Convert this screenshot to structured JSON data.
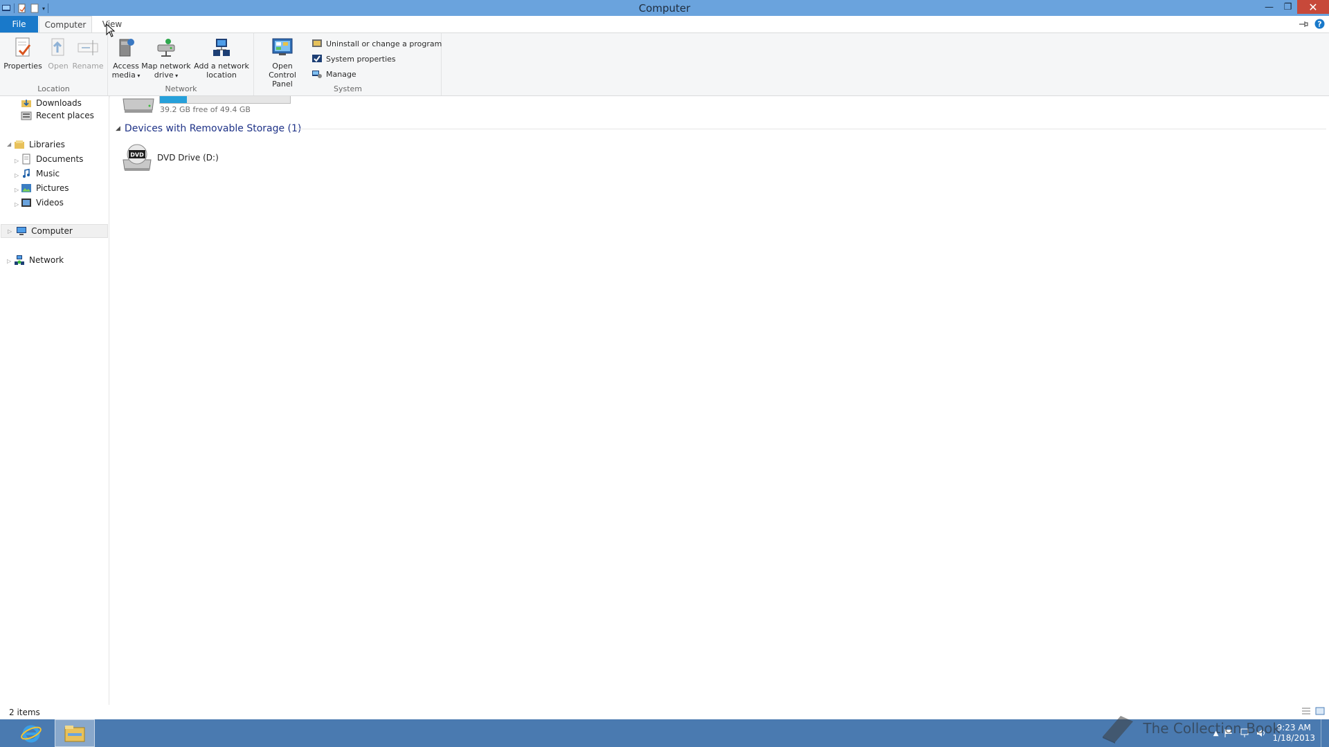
{
  "window": {
    "title": "Computer"
  },
  "tabs": {
    "file": "File",
    "computer": "Computer",
    "view": "View"
  },
  "ribbon": {
    "location": {
      "label": "Location",
      "properties": "Properties",
      "open": "Open",
      "rename": "Rename"
    },
    "network": {
      "label": "Network",
      "access_media_1": "Access",
      "access_media_2": "media",
      "map_drive_1": "Map network",
      "map_drive_2": "drive",
      "add_location_1": "Add a network",
      "add_location_2": "location"
    },
    "system": {
      "label": "System",
      "control_panel_1": "Open Control",
      "control_panel_2": "Panel",
      "uninstall": "Uninstall or change a program",
      "system_properties": "System properties",
      "manage": "Manage"
    }
  },
  "nav": {
    "downloads": "Downloads",
    "recent": "Recent places",
    "libraries": "Libraries",
    "documents": "Documents",
    "music": "Music",
    "pictures": "Pictures",
    "videos": "Videos",
    "computer": "Computer",
    "network": "Network"
  },
  "content": {
    "drive_free": "39.2 GB free of 49.4 GB",
    "drive_used_fraction": 0.21,
    "removable_section": "Devices with Removable Storage (1)",
    "dvd_label": "DVD Drive (D:)",
    "dvd_badge": "DVD"
  },
  "status": {
    "item_count": "2 items"
  },
  "taskbar": {
    "time": "9:23 AM",
    "date": "1/18/2013"
  },
  "watermark": {
    "text": "The Collection Book"
  },
  "colors": {
    "titlebar": "#6aa3dd",
    "file_tab": "#1979ca",
    "taskbar": "#4a7ab0",
    "close_button": "#c7493a",
    "drive_fill": "#26a0da",
    "section_heading": "#1e3287"
  }
}
